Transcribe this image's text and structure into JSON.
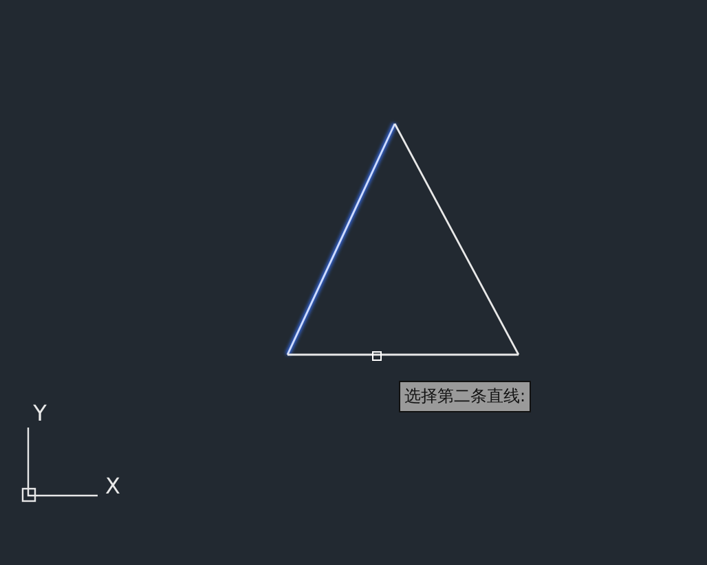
{
  "drawing": {
    "edges": [
      {
        "kind": "line",
        "selected": true
      },
      {
        "kind": "line",
        "selected": false
      },
      {
        "kind": "line",
        "selected": false
      }
    ]
  },
  "prompt_tooltip": {
    "text": "选择第二条直线:"
  },
  "ucs": {
    "x_label": "X",
    "y_label": "Y"
  }
}
